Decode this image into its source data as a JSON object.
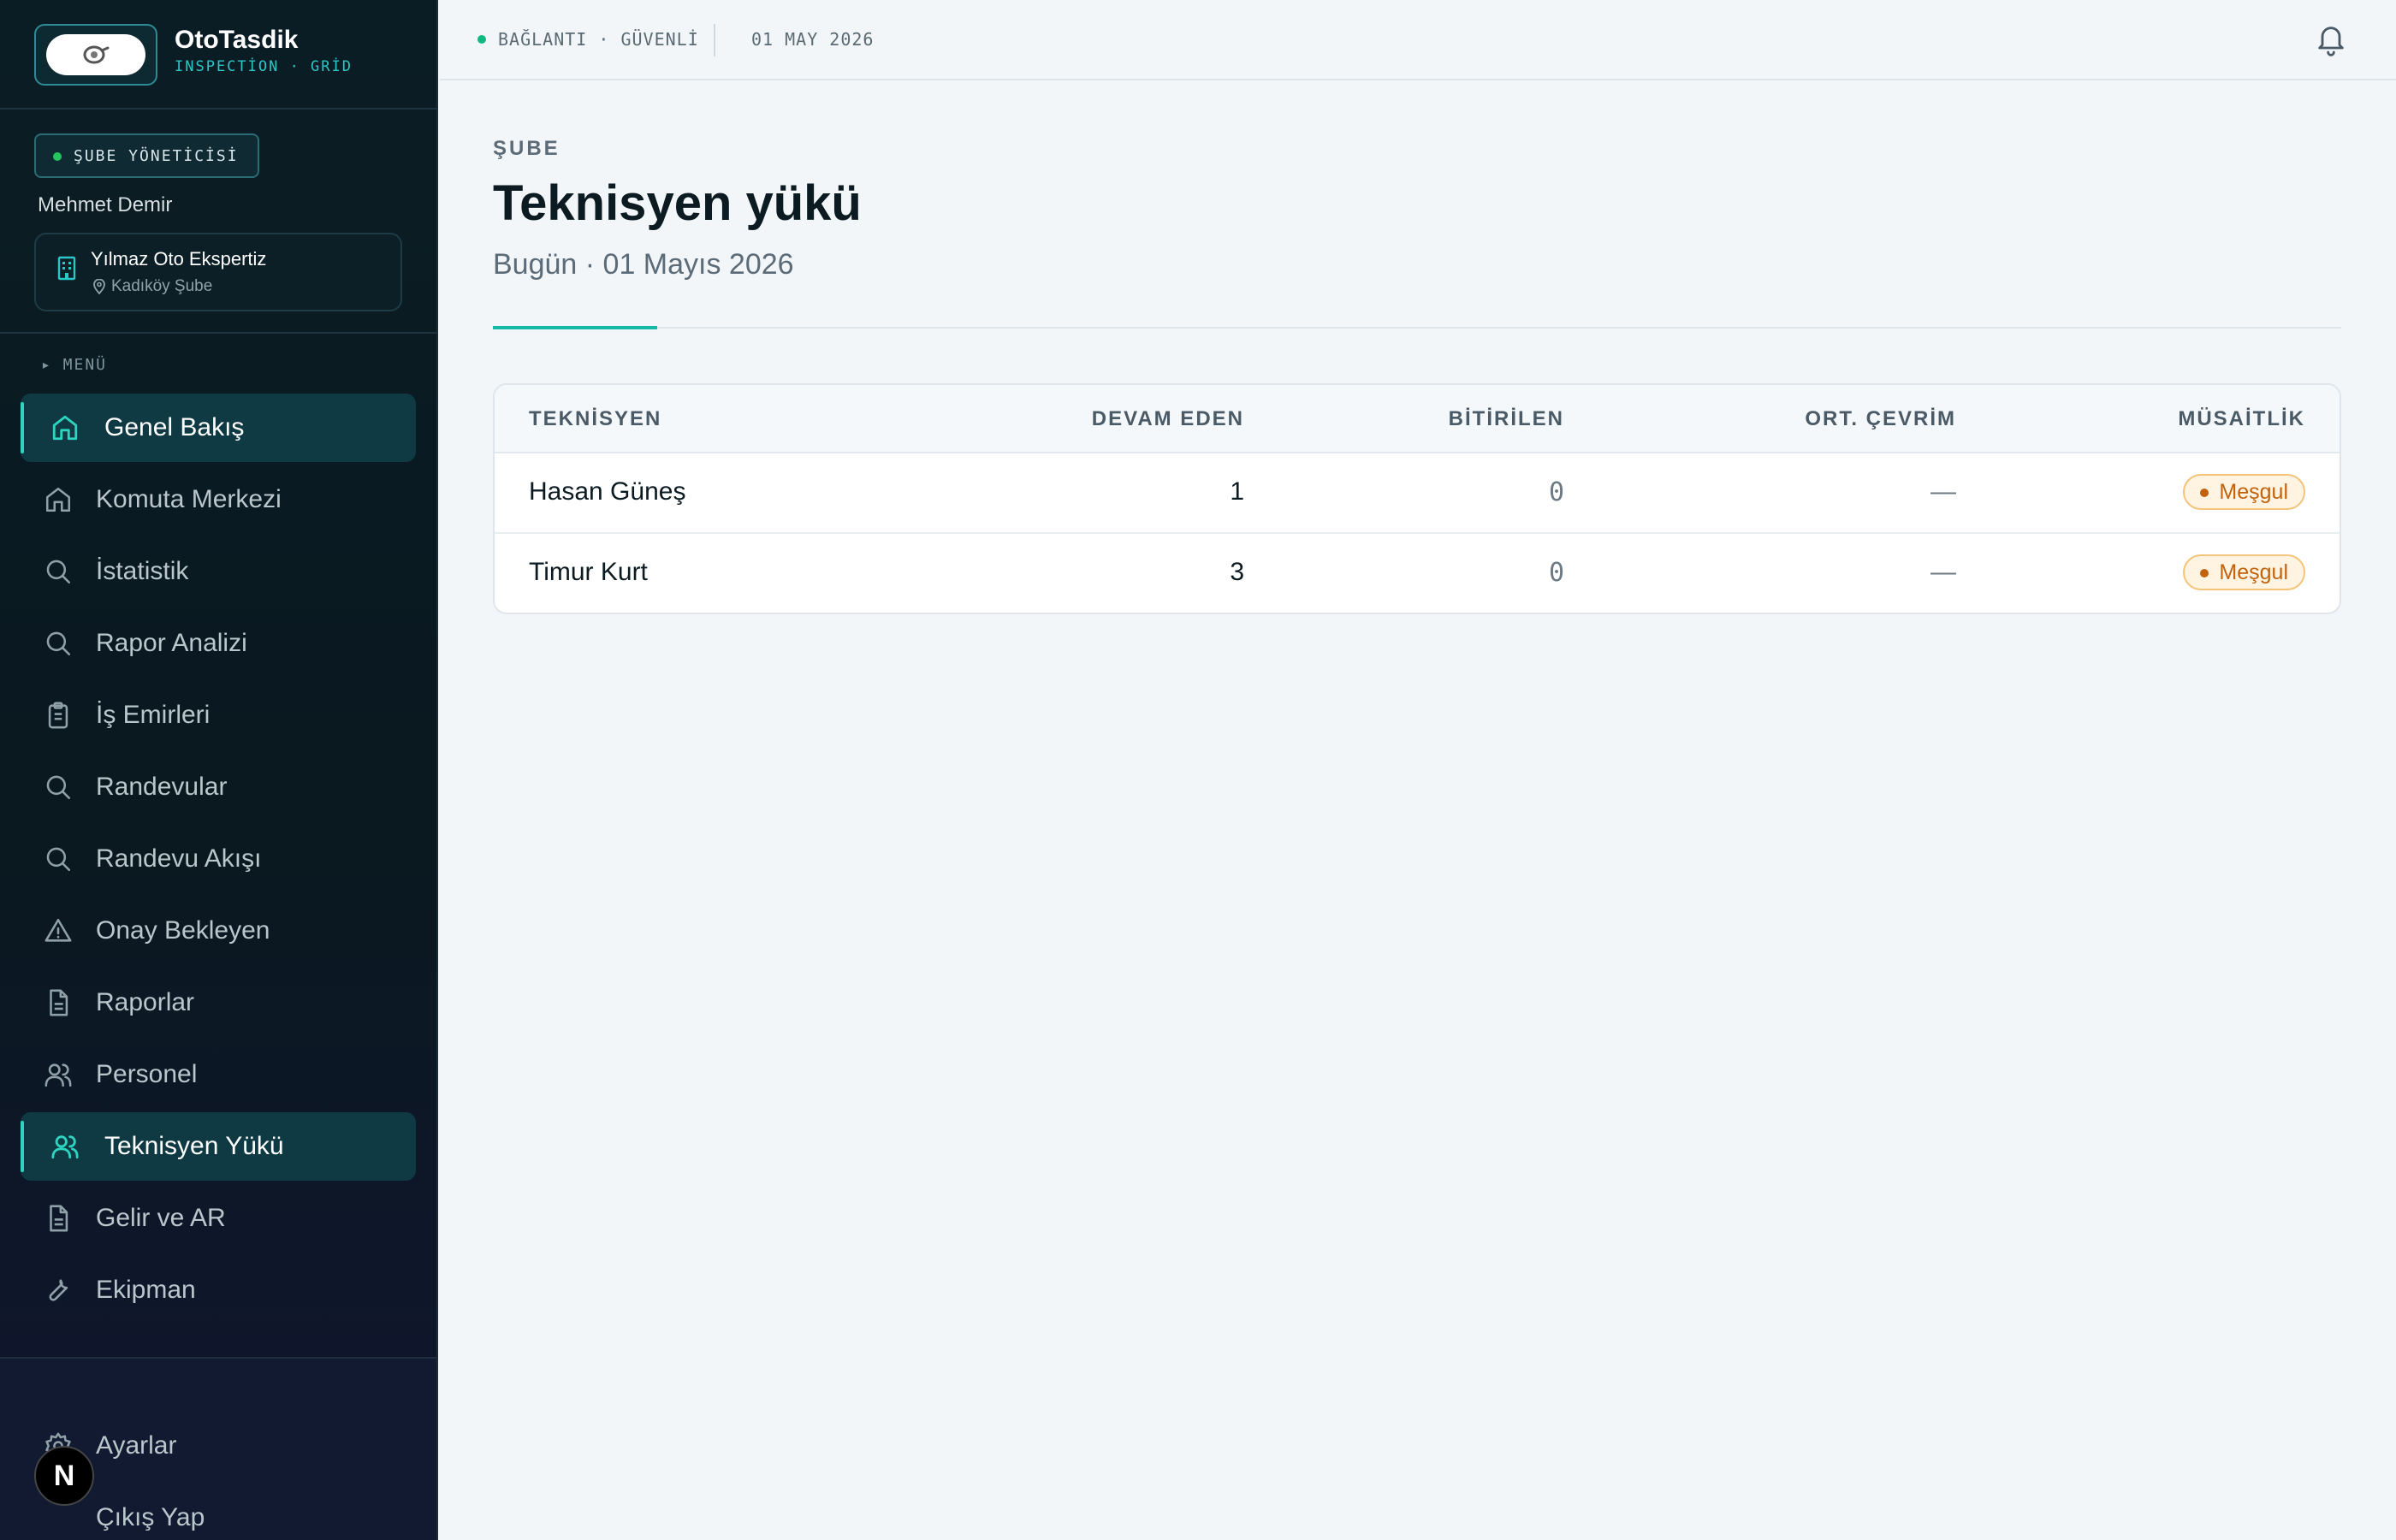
{
  "brand": {
    "name": "OtoTasdik",
    "subtitle": "INSPECTİON · GRİD"
  },
  "user": {
    "role": "ŞUBE YÖNETİCİSİ",
    "name": "Mehmet Demir",
    "branch_name": "Yılmaz Oto Ekspertiz",
    "branch_location": "Kadıköy Şube"
  },
  "menu": {
    "label": "▸ MENÜ",
    "items": [
      {
        "label": "Genel Bakış",
        "icon": "home-icon",
        "active": true
      },
      {
        "label": "Komuta Merkezi",
        "icon": "home-icon",
        "active": false
      },
      {
        "label": "İstatistik",
        "icon": "search-icon",
        "active": false
      },
      {
        "label": "Rapor Analizi",
        "icon": "search-icon",
        "active": false
      },
      {
        "label": "İş Emirleri",
        "icon": "clipboard-icon",
        "active": false
      },
      {
        "label": "Randevular",
        "icon": "search-icon",
        "active": false
      },
      {
        "label": "Randevu Akışı",
        "icon": "search-icon",
        "active": false
      },
      {
        "label": "Onay Bekleyen",
        "icon": "warning-icon",
        "active": false
      },
      {
        "label": "Raporlar",
        "icon": "file-icon",
        "active": false
      },
      {
        "label": "Personel",
        "icon": "users-icon",
        "active": false
      },
      {
        "label": "Teknisyen Yükü",
        "icon": "users-icon",
        "active": true
      },
      {
        "label": "Gelir ve AR",
        "icon": "file-icon",
        "active": false
      },
      {
        "label": "Ekipman",
        "icon": "wrench-icon",
        "active": false
      }
    ],
    "bottom": [
      {
        "label": "Ayarlar",
        "icon": "gear-icon"
      },
      {
        "label": "Çıkış Yap",
        "icon": "logout-icon"
      }
    ]
  },
  "avatar_letter": "N",
  "topbar": {
    "connection": "BAĞLANTI · GÜVENLİ",
    "date": "01 MAY 2026"
  },
  "page": {
    "eyebrow": "ŞUBE",
    "title": "Teknisyen yükü",
    "subtitle": "Bugün · 01 Mayıs 2026"
  },
  "table": {
    "headers": [
      "TEKNİSYEN",
      "DEVAM EDEN",
      "BİTİRİLEN",
      "ORT. ÇEVRİM",
      "MÜSAİTLİK"
    ],
    "rows": [
      {
        "name": "Hasan Güneş",
        "ongoing": "1",
        "finished": "0",
        "avg_cycle": "—",
        "availability": "Meşgul"
      },
      {
        "name": "Timur Kurt",
        "ongoing": "3",
        "finished": "0",
        "avg_cycle": "—",
        "availability": "Meşgul"
      }
    ]
  },
  "colors": {
    "accent": "#14b8a6",
    "busy": "#c2620c",
    "sidebar_bg": "#0b1d24"
  }
}
